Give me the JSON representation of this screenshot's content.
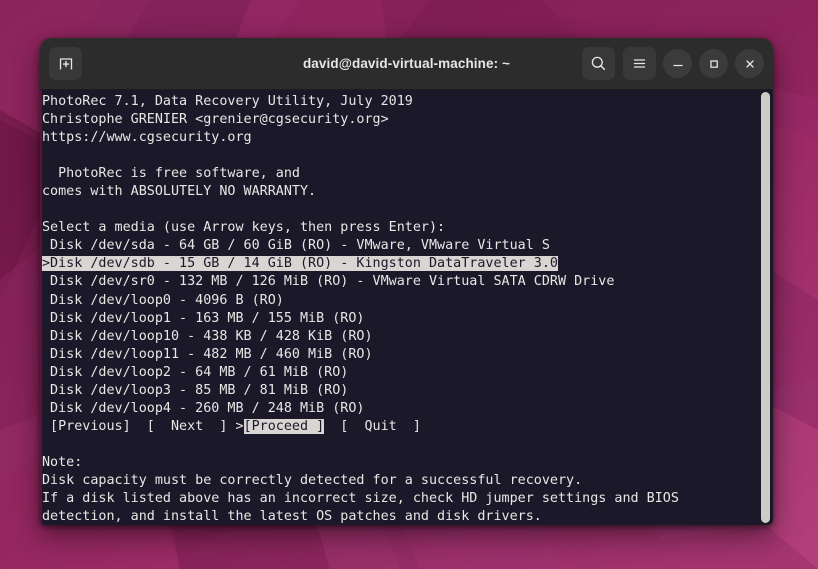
{
  "desktop": {
    "wallpaper_name": "ubuntu-jammy-wallpaper",
    "colors": {
      "base": "#8e2159",
      "shade_dark": "#6c1644",
      "shade_mid": "#9b2a66",
      "shade_light": "#b43c79",
      "shade_violet": "#7d2a77"
    }
  },
  "window": {
    "title": "david@david-virtual-machine: ~",
    "titlebar": {
      "new_tab_icon": "new-tab-icon",
      "search_icon": "search-icon",
      "menu_icon": "hamburger-menu-icon",
      "minimize_icon": "minimize-icon",
      "maximize_icon": "maximize-icon",
      "close_icon": "close-icon"
    },
    "colors": {
      "titlebar_bg": "#2c2c2c",
      "terminal_bg": "#1b182a",
      "terminal_fg": "#e9e6e3",
      "highlight_bg": "#d8d5d2",
      "highlight_fg": "#1b182a",
      "scrollbar_thumb": "#cfcbc7"
    }
  },
  "terminal": {
    "lines": [
      {
        "text": "PhotoRec 7.1, Data Recovery Utility, July 2019",
        "highlight": null
      },
      {
        "text": "Christophe GRENIER <grenier@cgsecurity.org>",
        "highlight": null
      },
      {
        "text": "https://www.cgsecurity.org",
        "highlight": null
      },
      {
        "text": "",
        "highlight": null
      },
      {
        "text": "  PhotoRec is free software, and",
        "highlight": null
      },
      {
        "text": "comes with ABSOLUTELY NO WARRANTY.",
        "highlight": null
      },
      {
        "text": "",
        "highlight": null
      },
      {
        "text": "Select a media (use Arrow keys, then press Enter):",
        "highlight": null
      },
      {
        "text": " Disk /dev/sda - 64 GB / 60 GiB (RO) - VMware, VMware Virtual S",
        "highlight": null
      },
      {
        "text": ">Disk /dev/sdb - 15 GB / 14 GiB (RO) - Kingston DataTraveler 3.0",
        "highlight": [
          0,
          64
        ]
      },
      {
        "text": " Disk /dev/sr0 - 132 MB / 126 MiB (RO) - VMware Virtual SATA CDRW Drive",
        "highlight": null
      },
      {
        "text": " Disk /dev/loop0 - 4096 B (RO)",
        "highlight": null
      },
      {
        "text": " Disk /dev/loop1 - 163 MB / 155 MiB (RO)",
        "highlight": null
      },
      {
        "text": " Disk /dev/loop10 - 438 KB / 428 KiB (RO)",
        "highlight": null
      },
      {
        "text": " Disk /dev/loop11 - 482 MB / 460 MiB (RO)",
        "highlight": null
      },
      {
        "text": " Disk /dev/loop2 - 64 MB / 61 MiB (RO)",
        "highlight": null
      },
      {
        "text": " Disk /dev/loop3 - 85 MB / 81 MiB (RO)",
        "highlight": null
      },
      {
        "text": " Disk /dev/loop4 - 260 MB / 248 MiB (RO)",
        "highlight": null
      },
      {
        "text": " [Previous]  [  Next  ] >[Proceed ]  [  Quit  ]",
        "highlight": [
          25,
          35
        ]
      },
      {
        "text": "",
        "highlight": null
      },
      {
        "text": "Note:",
        "highlight": null
      },
      {
        "text": "Disk capacity must be correctly detected for a successful recovery.",
        "highlight": null
      },
      {
        "text": "If a disk listed above has an incorrect size, check HD jumper settings and BIOS",
        "highlight": null
      },
      {
        "text": "detection, and install the latest OS patches and disk drivers.",
        "highlight": null
      }
    ],
    "program": {
      "name": "PhotoRec",
      "version": "7.1",
      "description": "Data Recovery Utility",
      "release": "July 2019",
      "author": "Christophe GRENIER",
      "author_email": "grenier@cgsecurity.org",
      "website": "https://www.cgsecurity.org"
    },
    "prompt": "Select a media (use Arrow keys, then press Enter):",
    "disks": [
      {
        "device": "/dev/sda",
        "size": "64 GB",
        "size_gib": "60 GiB",
        "flags": "(RO)",
        "model": "VMware, VMware Virtual S",
        "selected": false
      },
      {
        "device": "/dev/sdb",
        "size": "15 GB",
        "size_gib": "14 GiB",
        "flags": "(RO)",
        "model": "Kingston DataTraveler 3.0",
        "selected": true
      },
      {
        "device": "/dev/sr0",
        "size": "132 MB",
        "size_gib": "126 MiB",
        "flags": "(RO)",
        "model": "VMware Virtual SATA CDRW Drive",
        "selected": false
      },
      {
        "device": "/dev/loop0",
        "size": "4096 B",
        "size_gib": "",
        "flags": "(RO)",
        "model": "",
        "selected": false
      },
      {
        "device": "/dev/loop1",
        "size": "163 MB",
        "size_gib": "155 MiB",
        "flags": "(RO)",
        "model": "",
        "selected": false
      },
      {
        "device": "/dev/loop10",
        "size": "438 KB",
        "size_gib": "428 KiB",
        "flags": "(RO)",
        "model": "",
        "selected": false
      },
      {
        "device": "/dev/loop11",
        "size": "482 MB",
        "size_gib": "460 MiB",
        "flags": "(RO)",
        "model": "",
        "selected": false
      },
      {
        "device": "/dev/loop2",
        "size": "64 MB",
        "size_gib": "61 MiB",
        "flags": "(RO)",
        "model": "",
        "selected": false
      },
      {
        "device": "/dev/loop3",
        "size": "85 MB",
        "size_gib": "81 MiB",
        "flags": "(RO)",
        "model": "",
        "selected": false
      },
      {
        "device": "/dev/loop4",
        "size": "260 MB",
        "size_gib": "248 MiB",
        "flags": "(RO)",
        "model": "",
        "selected": false
      }
    ],
    "buttons": [
      {
        "label": "[Previous]",
        "selected": false
      },
      {
        "label": "[  Next  ]",
        "selected": false
      },
      {
        "label": "[Proceed ]",
        "selected": true
      },
      {
        "label": "[  Quit  ]",
        "selected": false
      }
    ],
    "note": {
      "heading": "Note:",
      "body": [
        "Disk capacity must be correctly detected for a successful recovery.",
        "If a disk listed above has an incorrect size, check HD jumper settings and BIOS",
        "detection, and install the latest OS patches and disk drivers."
      ]
    }
  }
}
